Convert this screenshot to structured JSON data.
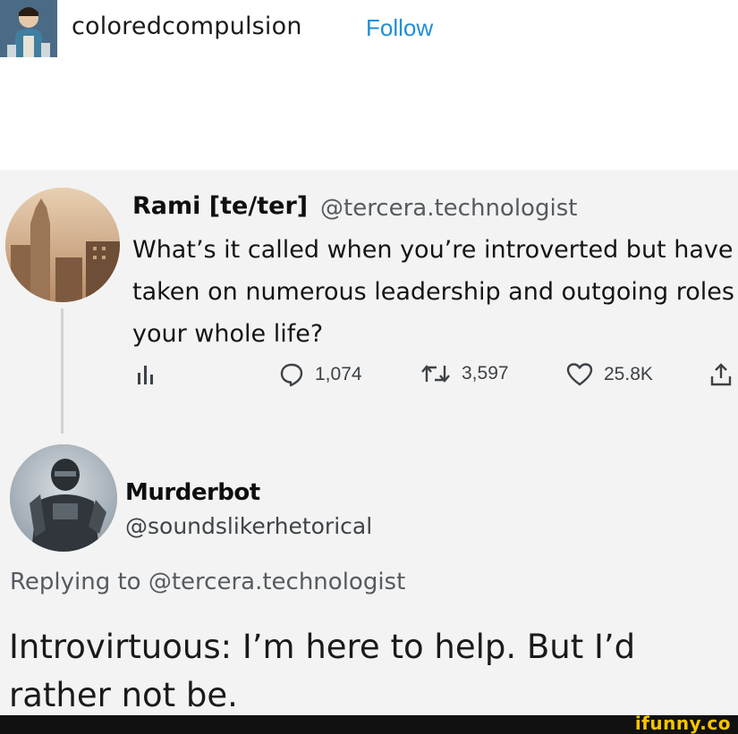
{
  "header": {
    "username": "coloredcompulsion",
    "follow_label": "Follow"
  },
  "tweet": {
    "author_name": "Rami [te/ter]",
    "author_handle": "@tercera.technologist",
    "text": "What’s it called when you’re introverted but have taken on numerous leadership and outgoing roles your whole life?",
    "stats": {
      "replies": "1,074",
      "retweets": "3,597",
      "likes": "25.8K"
    }
  },
  "reply": {
    "author_name": "Murderbot",
    "author_handle": "@soundslikerhetorical",
    "replying_prefix": "Replying to",
    "replying_to": "@tercera.technologist",
    "text": "Introvirtuous: I’m here to help. But I’d rather not be."
  },
  "watermark": {
    "text": "ifunny.co"
  },
  "colors": {
    "follow": "#1f8fd6",
    "card_bg": "#f3f3f3",
    "watermark": "#f5c400"
  },
  "icons": {
    "analytics": "analytics-icon",
    "reply": "reply-icon",
    "retweet": "retweet-icon",
    "like": "heart-icon",
    "share": "share-icon"
  }
}
